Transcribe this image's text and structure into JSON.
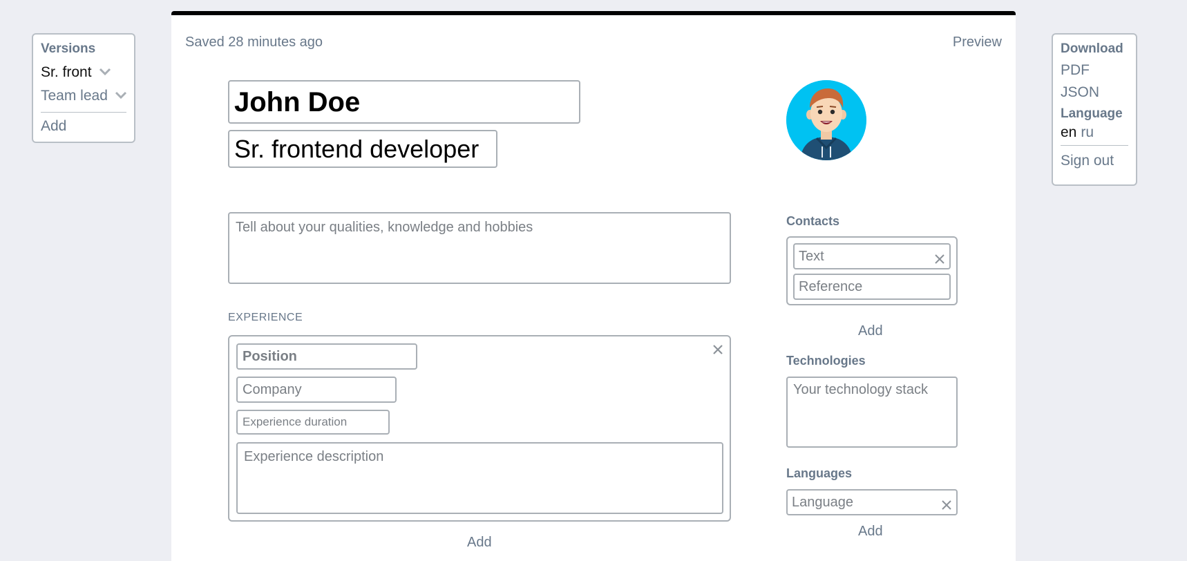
{
  "versions": {
    "title": "Versions",
    "items": [
      {
        "label": "Sr. front",
        "active": true
      },
      {
        "label": "Team lead",
        "active": false
      }
    ],
    "add_label": "Add"
  },
  "download": {
    "title": "Download",
    "pdf": "PDF",
    "json": "JSON",
    "language_title": "Language",
    "language_current": "en",
    "language_other": "ru",
    "sign_out": "Sign out"
  },
  "header": {
    "saved": "Saved 28 minutes ago",
    "preview": "Preview"
  },
  "profile": {
    "name": "John Doe",
    "title": "Sr. frontend developer",
    "about_placeholder": "Tell about your qualities, knowledge and hobbies"
  },
  "experience": {
    "section_label": "EXPERIENCE",
    "position_placeholder": "Position",
    "company_placeholder": "Company",
    "duration_placeholder": "Experience duration",
    "description_placeholder": "Experience description",
    "add_label": "Add"
  },
  "contacts": {
    "label": "Contacts",
    "text_placeholder": "Text",
    "reference_placeholder": "Reference",
    "add_label": "Add"
  },
  "technologies": {
    "label": "Technologies",
    "placeholder": "Your technology stack"
  },
  "languages": {
    "label": "Languages",
    "placeholder": "Language",
    "add_label": "Add"
  },
  "colors": {
    "background": "#edeef3",
    "muted_text": "#68788a",
    "border": "#a9afb5",
    "avatar_bg": "#00c2f2",
    "sheet_top_bar": "#000000"
  }
}
